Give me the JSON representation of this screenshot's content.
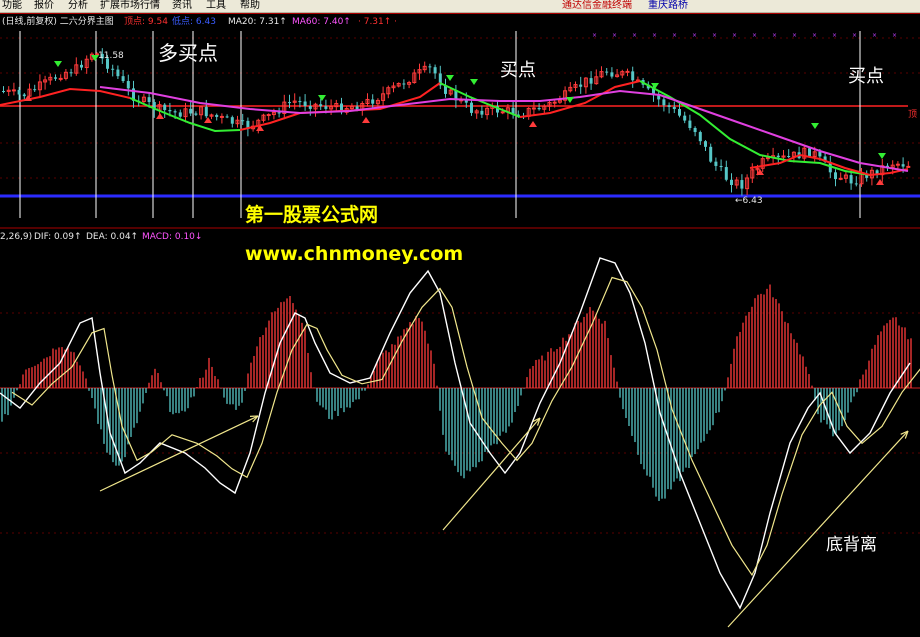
{
  "menu": {
    "items": [
      "功能",
      "报价",
      "分析",
      "扩展市场行情",
      "资讯",
      "工具",
      "帮助"
    ],
    "right_items": [
      "通达信金融终端",
      "重庆路桥"
    ]
  },
  "price_panel": {
    "title": "(日线,前复权) 二六分界主图",
    "legend": [
      {
        "text": "顶点: 9.54",
        "color": "#ff3030"
      },
      {
        "text": "低点: 6.43",
        "color": "#3a5cff"
      },
      {
        "text": "MA20: 7.31↑",
        "color": "#e8e8e8"
      },
      {
        "text": "MA60: 7.40↑",
        "color": "#ff55ff"
      },
      {
        "text": "· 7.31↑ ·",
        "color": "#ff3030"
      }
    ],
    "high_label": "11.58",
    "low_label": "←6.43",
    "axis_mark": "顶",
    "annotations": [
      "多买点",
      "买点",
      "买点"
    ],
    "watermark": [
      "第一股票公式网",
      "www.chnmoney.com"
    ]
  },
  "macd_panel": {
    "legend": [
      {
        "text": "2,26,9)",
        "color": "#e8e8e8"
      },
      {
        "text": "DIF: 0.09↑",
        "color": "#e8e8e8"
      },
      {
        "text": "DEA: 0.04↑",
        "color": "#e8e8e8"
      },
      {
        "text": "MACD: 0.10↓",
        "color": "#ff55ff"
      }
    ],
    "annotation": "底背离"
  },
  "chart_data": {
    "type": "line",
    "title": "",
    "price": {
      "high": 11.58,
      "low": 6.43,
      "ma20": 7.31,
      "ma60": 7.4,
      "red_level": 7.31
    },
    "macd": {
      "dif": 0.09,
      "dea": 0.04,
      "macd": 0.1
    },
    "colors": {
      "up": "#ff3b3b",
      "down": "#56c7c7",
      "ma_red": "#ff2222",
      "ma_green": "#33ee33",
      "ma_magenta": "#e040e0",
      "dif": "#ffffff",
      "dea": "#f0e68c",
      "watermark": "#ffff00",
      "zero_axis": "#cc2222",
      "low_axis": "#2b2bff"
    }
  }
}
